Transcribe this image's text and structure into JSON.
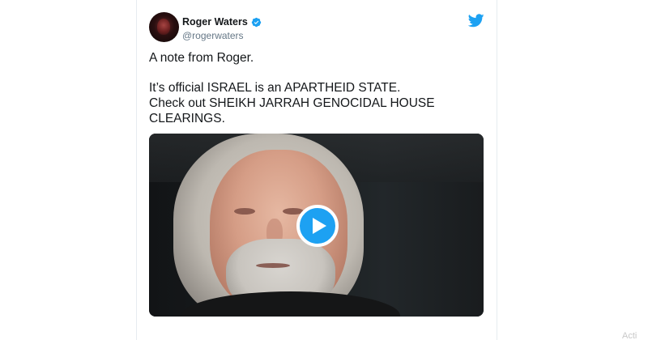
{
  "tweet": {
    "author_name": "Roger Waters",
    "author_handle": "@rogerwaters",
    "verified": true,
    "lines": [
      "A note from Roger.",
      "It’s official ISRAEL is an APARTHEID STATE.",
      "Check out SHEIKH JARRAH GENOCIDAL HOUSE",
      "CLEARINGS."
    ],
    "media_type": "video"
  },
  "icons": {
    "brand": "twitter-bird-icon",
    "badge": "verified-icon",
    "play": "play-icon"
  },
  "colors": {
    "brand": "#1da1f2",
    "text": "#14171a",
    "secondary_text": "#657786"
  },
  "watermark": "Acti"
}
